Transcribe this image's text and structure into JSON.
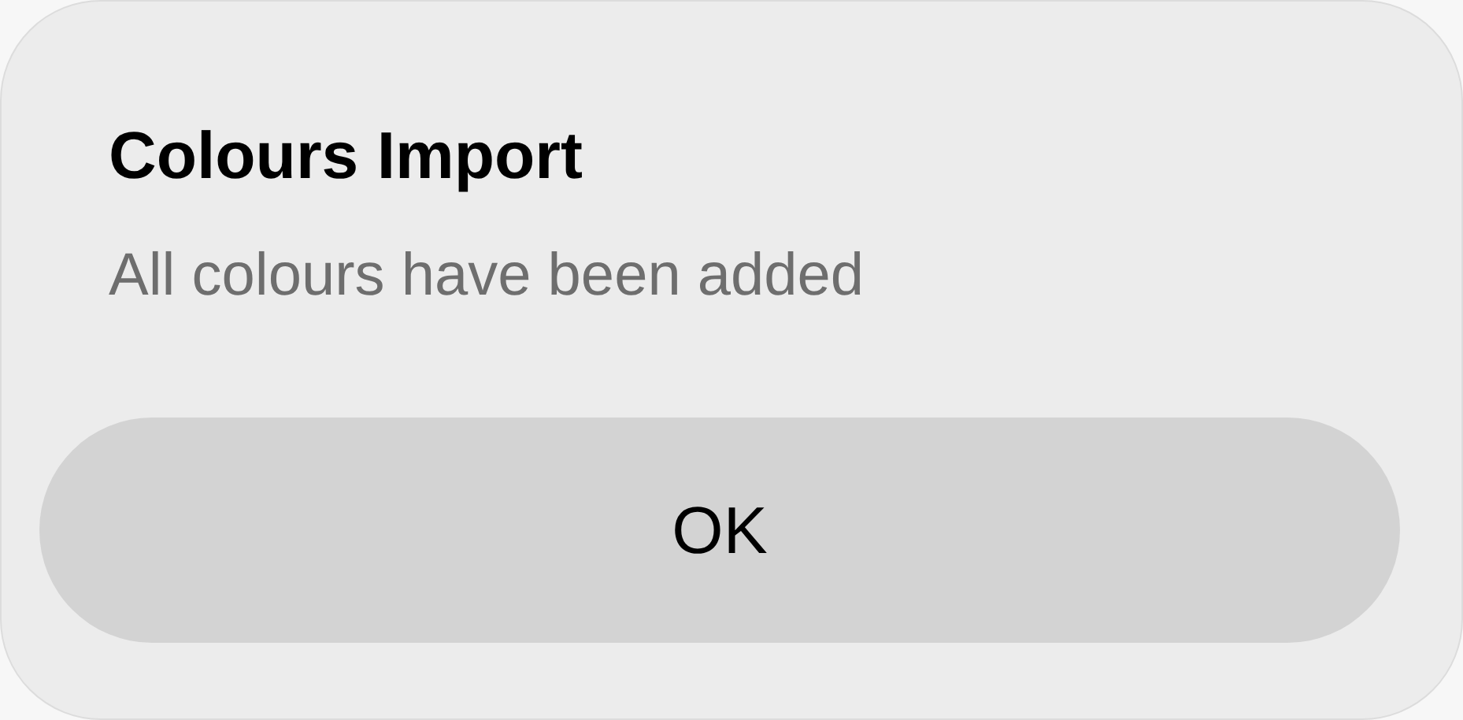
{
  "alert": {
    "title": "Colours Import",
    "message": "All colours have been added",
    "buttons": [
      "OK"
    ]
  }
}
